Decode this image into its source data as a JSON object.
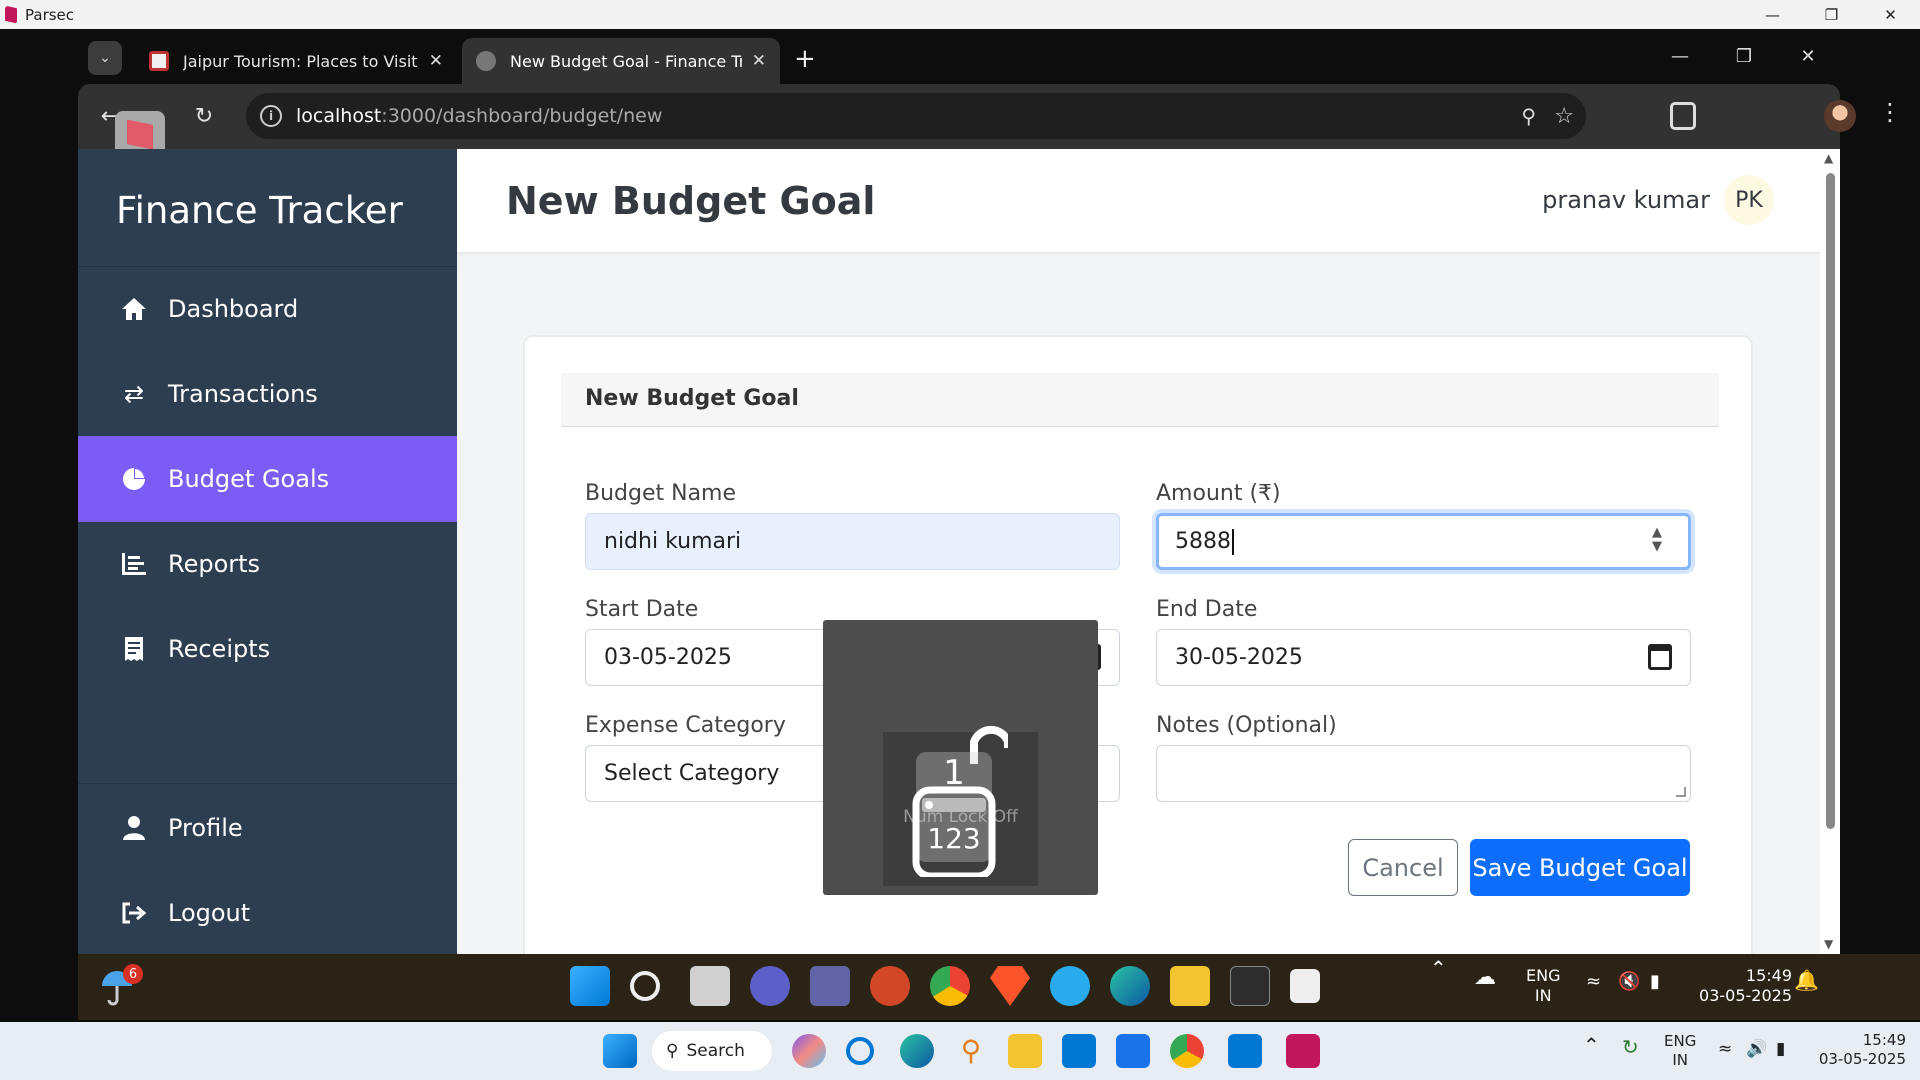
{
  "host_window": {
    "title": "Parsec"
  },
  "browser": {
    "tabs": [
      {
        "title": "Jaipur Tourism: Places to Visit, S",
        "active": false
      },
      {
        "title": "New Budget Goal - Finance Tra",
        "active": true
      }
    ],
    "url_host": "localhost",
    "url_path": ":3000/dashboard/budget/new"
  },
  "app": {
    "brand": "Finance Tracker",
    "nav": [
      {
        "label": "Dashboard",
        "icon": "home-icon",
        "active": false
      },
      {
        "label": "Transactions",
        "icon": "arrows-swap-icon",
        "active": false
      },
      {
        "label": "Budget Goals",
        "icon": "pie-chart-icon",
        "active": true
      },
      {
        "label": "Reports",
        "icon": "list-icon",
        "active": false
      },
      {
        "label": "Receipts",
        "icon": "receipt-icon",
        "active": false
      }
    ],
    "nav_bottom": [
      {
        "label": "Profile",
        "icon": "user-icon"
      },
      {
        "label": "Logout",
        "icon": "logout-icon"
      }
    ],
    "accent_color": "#7b5cf5",
    "sidebar_color": "#2c3e50"
  },
  "header": {
    "title": "New Budget Goal",
    "user_name": "pranav kumar",
    "user_initials": "PK"
  },
  "form": {
    "card_title": "New Budget Goal",
    "budget_name_label": "Budget Name",
    "budget_name_value": "nidhi kumari",
    "amount_label": "Amount (₹)",
    "amount_value": "5888",
    "start_date_label": "Start Date",
    "start_date_value": "03-05-2025",
    "end_date_label": "End Date",
    "end_date_value": "30-05-2025",
    "category_label": "Expense Category",
    "category_value": "Select Category",
    "notes_label": "Notes (Optional)",
    "notes_value": "",
    "cancel_label": "Cancel",
    "save_label": "Save Budget Goal",
    "primary_color": "#0d6efd"
  },
  "osd": {
    "text": "Num Lock Off",
    "key_label": "1",
    "badge_label": "123"
  },
  "remote_taskbar": {
    "weather_badge": "6",
    "lang_line1": "ENG",
    "lang_line2": "IN",
    "time": "15:49",
    "date": "03-05-2025"
  },
  "host_taskbar": {
    "search_label": "Search",
    "lang_line1": "ENG",
    "lang_line2": "IN",
    "time": "15:49",
    "date": "03-05-2025"
  }
}
